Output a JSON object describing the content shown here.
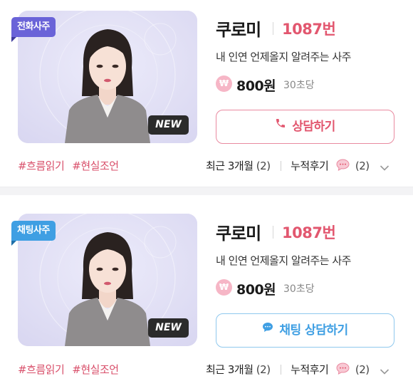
{
  "cards": [
    {
      "type_label": "전화사주",
      "new_label": "NEW",
      "name": "쿠로미",
      "number": "1087번",
      "description": "내 인연 언제올지 알려주는 사주",
      "currency_symbol": "₩",
      "price": "800원",
      "price_unit": "30초당",
      "button_label": "상담하기",
      "tags": [
        "#흐름읽기",
        "#현실조언"
      ],
      "recent_label": "최근 3개월",
      "recent_count": "(2)",
      "reviews_label": "누적후기",
      "reviews_count": "(2)"
    },
    {
      "type_label": "채팅사주",
      "new_label": "NEW",
      "name": "쿠로미",
      "number": "1087번",
      "description": "내 인연 언제올지 알려주는 사주",
      "currency_symbol": "₩",
      "price": "800원",
      "price_unit": "30초당",
      "button_label": "채팅 상담하기",
      "tags": [
        "#흐름읽기",
        "#현실조언"
      ],
      "recent_label": "최근 3개월",
      "recent_count": "(2)",
      "reviews_label": "누적후기",
      "reviews_count": "(2)"
    }
  ],
  "colors": {
    "accent_pink": "#e2576f",
    "accent_blue": "#3f9fe3",
    "phone_badge": "#6a63d8",
    "chat_badge": "#3f9fe3"
  },
  "icons": [
    "phone-icon",
    "chat-icon",
    "won-icon",
    "review-bubble-icon",
    "chevron-down-icon"
  ]
}
